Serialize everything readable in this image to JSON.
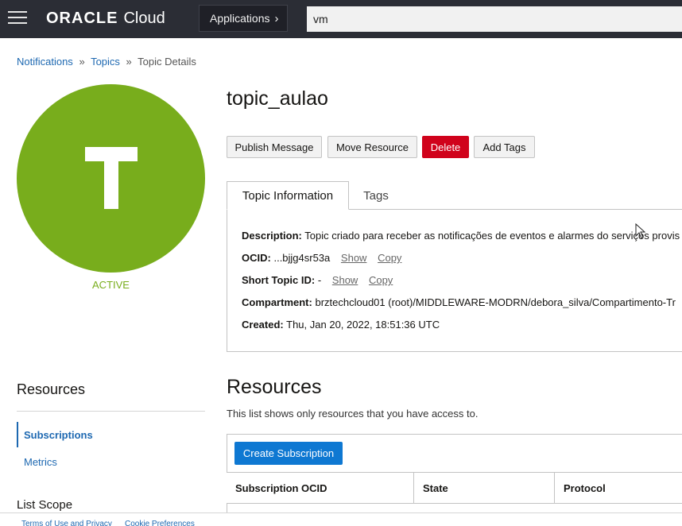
{
  "header": {
    "brand_oracle": "ORACLE",
    "brand_cloud": "Cloud",
    "applications_label": "Applications",
    "search_value": "vm"
  },
  "breadcrumb": {
    "notifications": "Notifications",
    "topics": "Topics",
    "current": "Topic Details",
    "separator": "»"
  },
  "topic": {
    "avatar_letter": "T",
    "status": "ACTIVE",
    "title": "topic_aulao",
    "status_color": "#78ad1c"
  },
  "actions": {
    "publish": "Publish Message",
    "move": "Move Resource",
    "delete": "Delete",
    "add_tags": "Add Tags"
  },
  "tabs": {
    "info": "Topic Information",
    "tags": "Tags"
  },
  "info": {
    "description_label": "Description:",
    "description_value": "Topic criado para receber as notificações de eventos e alarmes do serviços provis",
    "ocid_label": "OCID:",
    "ocid_value": "...bjjg4sr53a",
    "short_id_label": "Short Topic ID:",
    "short_id_value": "-",
    "compartment_label": "Compartment:",
    "compartment_value": "brztechcloud01 (root)/MIDDLEWARE-MODRN/debora_silva/Compartimento-Tr",
    "created_label": "Created:",
    "created_value": "Thu, Jan 20, 2022, 18:51:36 UTC",
    "show_label": "Show",
    "copy_label": "Copy"
  },
  "sidebar": {
    "resources_heading": "Resources",
    "items": [
      {
        "label": "Subscriptions"
      },
      {
        "label": "Metrics"
      }
    ],
    "list_scope": "List Scope"
  },
  "resources": {
    "heading": "Resources",
    "note": "This list shows only resources that you have access to.",
    "create_button": "Create Subscription",
    "columns": [
      "Subscription OCID",
      "State",
      "Protocol"
    ]
  },
  "footer": {
    "terms": "Terms of Use and Privacy",
    "cookies": "Cookie Preferences"
  },
  "colors": {
    "header_bg": "#2b2d35",
    "accent_blue": "#1d68b1",
    "primary_button": "#0e78d2",
    "danger": "#d0021b",
    "active_green": "#78ad1c"
  },
  "icons": [
    "menu-icon",
    "chevron-right-icon",
    "mouse-pointer-icon"
  ]
}
